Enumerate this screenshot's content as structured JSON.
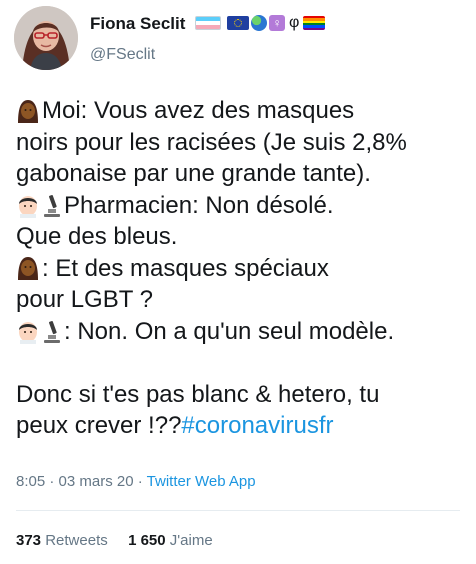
{
  "user": {
    "name": "Fiona Seclit",
    "handle": "@FSeclit",
    "badges": [
      "transgender-flag",
      "eu-flag",
      "globe-icon",
      "female-sign-icon",
      "phi-symbol",
      "rainbow-flag"
    ],
    "badge_phi": "φ",
    "badge_female": "♀"
  },
  "tweet": {
    "lines": [
      "Moi: Vous avez des masques",
      "noirs pour les racisées (Je suis 2,8%",
      "gabonaise par une grande tante).",
      "Pharmacien: Non désolé.",
      "Que des bleus.",
      ": Et des masques spéciaux",
      "pour LGBT ?",
      ": Non. On a qu'un seul modèle.",
      "Donc si t'es pas blanc & hetero, tu",
      "peux crever !??"
    ],
    "hashtag": "#coronavirusfr"
  },
  "meta": {
    "time": "8:05",
    "date": "03 mars 20",
    "separator": "·",
    "source": "Twitter Web App"
  },
  "stats": {
    "retweets_count": "373",
    "retweets_label": "Retweets",
    "likes_count": "1 650",
    "likes_label": "J'aime"
  },
  "colors": {
    "text": "#14171a",
    "muted": "#657786",
    "link": "#1b95e0",
    "divider": "#e6ecf0"
  }
}
